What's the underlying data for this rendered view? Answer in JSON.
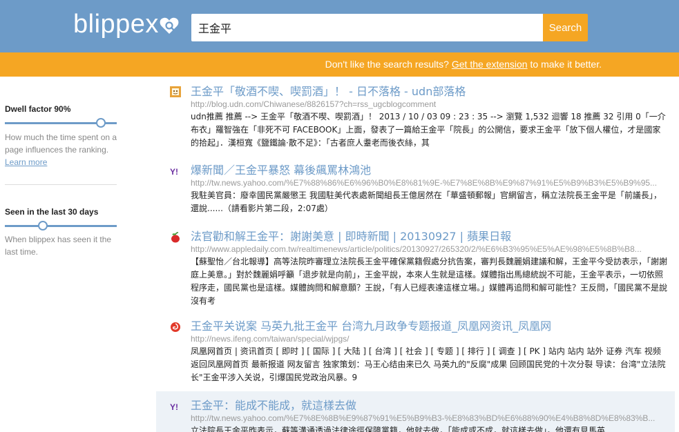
{
  "header": {
    "logo": "blippex",
    "search_value": "王金平",
    "search_button": "Search"
  },
  "banner": {
    "prefix": "Don't like the search results?",
    "link": "Get the extension",
    "suffix": "to make it better."
  },
  "sidebar": {
    "dwell": {
      "title": "Dwell factor 90%",
      "value_percent": 90,
      "desc": "How much the time spent on a page influences the ranking.",
      "learn_more": "Learn more"
    },
    "seen": {
      "title": "Seen in the last 30 days",
      "value_percent": 35,
      "desc": "When blippex has seen it the last time."
    }
  },
  "results": [
    {
      "icon": "udn-favicon-icon",
      "title": "王金平「敬酒不喫、喫罰酒」！ - 日不落格 - udn部落格",
      "url": "http://blog.udn.com/Chiwanese/8826157?ch=rss_ugcblogcomment",
      "snippet": "udn推薦 推薦 --> 王金平「敬酒不喫、喫罰酒」！ 2013 / 10 / 03 09 : 23 : 35 --> 瀏覽 1,532 迴響 18 推薦 32 引用 0「一介布衣」羅智強在「非死不可 FACEBOOK」上面，發表了一篇給王金平「院長」的公開信，要求王金平「放下個人權位，才是國家的拾起」．漢桓寬《鹽鐵論·散不足》：「古者庶人耋老而後衣絲，其"
    },
    {
      "icon": "yahoo-icon",
      "title": "爆新聞／王金平暴怒 幕後飆罵林鴻池",
      "url": "http://tw.news.yahoo.com/%E7%88%86%E6%96%B0%E8%81%9E-%E7%8E%8B%E9%87%91%E5%B9%B3%E5%B9%95...",
      "snippet": "我駐美官員：廢幸國民黨嚴懲王 我國駐美代表處新聞組長王億居然在「華盛頓郵報」官網留言，稱立法院長王金平是「前議長」，還說......（請看影片第二段，2:07處）"
    },
    {
      "icon": "apple-icon",
      "title": "法官勸和解王金平：謝謝美意 | 即時新聞 | 20130927 | 蘋果日報",
      "url": "http://www.appledaily.com.tw/realtimenews/article/politics/20130927/265320/2/%E6%B3%95%E5%AE%98%E5%8B%B8...",
      "snippet": "【蘇聖怡／台北報導】高等法院昨審理立法院長王金平確保黨籍假處分抗告案，審判長魏麗娟建議和解，王金平今受訪表示，「謝謝庭上美意。」對於魏麗娟呼籲「退步就是向前」，王金平說，本來人生就是這樣。媒體指出馬總統說不可能，王金平表示，一切依照程序走，國民黨也是這樣。媒體詢問和解意願？王說，「有人已經表達這樣立場。」媒體再追問和解可能性？王反問，「國民黨不是說沒有考"
    },
    {
      "icon": "ifeng-icon",
      "title": "王金平关说案 马英九批王金平 台湾九月政争专题报道_凤凰网资讯_凤凰网",
      "url": "http://news.ifeng.com/taiwan/special/wjpgs/",
      "snippet": "凤凰网首页 | 资讯首页 [ 即时 ] [ 国际 ] [ 大陆 ] [ 台湾 ] [ 社会 ] [ 专题 ] [ 排行 ] [ 调查 ] [ PK ] 站内 站内 站外 证券 汽车 视频 返回凤凰网首页 最新报道 网友留言 独家策划：马王心结由来已久 马英九的\"反腐\"成果 回顾国民党的十次分裂 导读：台湾\"立法院长\"王金平涉入关说，引爆国民党政治风暴。9"
    },
    {
      "icon": "yahoo-icon",
      "title": "王金平：能成不能成，就這樣去做",
      "url": "http://tw.news.yahoo.com/%E7%8E%8B%E9%87%91%E5%B9%B3-%E8%83%BD%E6%88%90%E4%B8%8D%E8%83%B...",
      "snippet": "立法院長王金平昨表示，蘇等溝通透過法律途徑保障黨籍，他就去做，「能成或不成，就這樣去做」。他還有見馬英"
    }
  ]
}
